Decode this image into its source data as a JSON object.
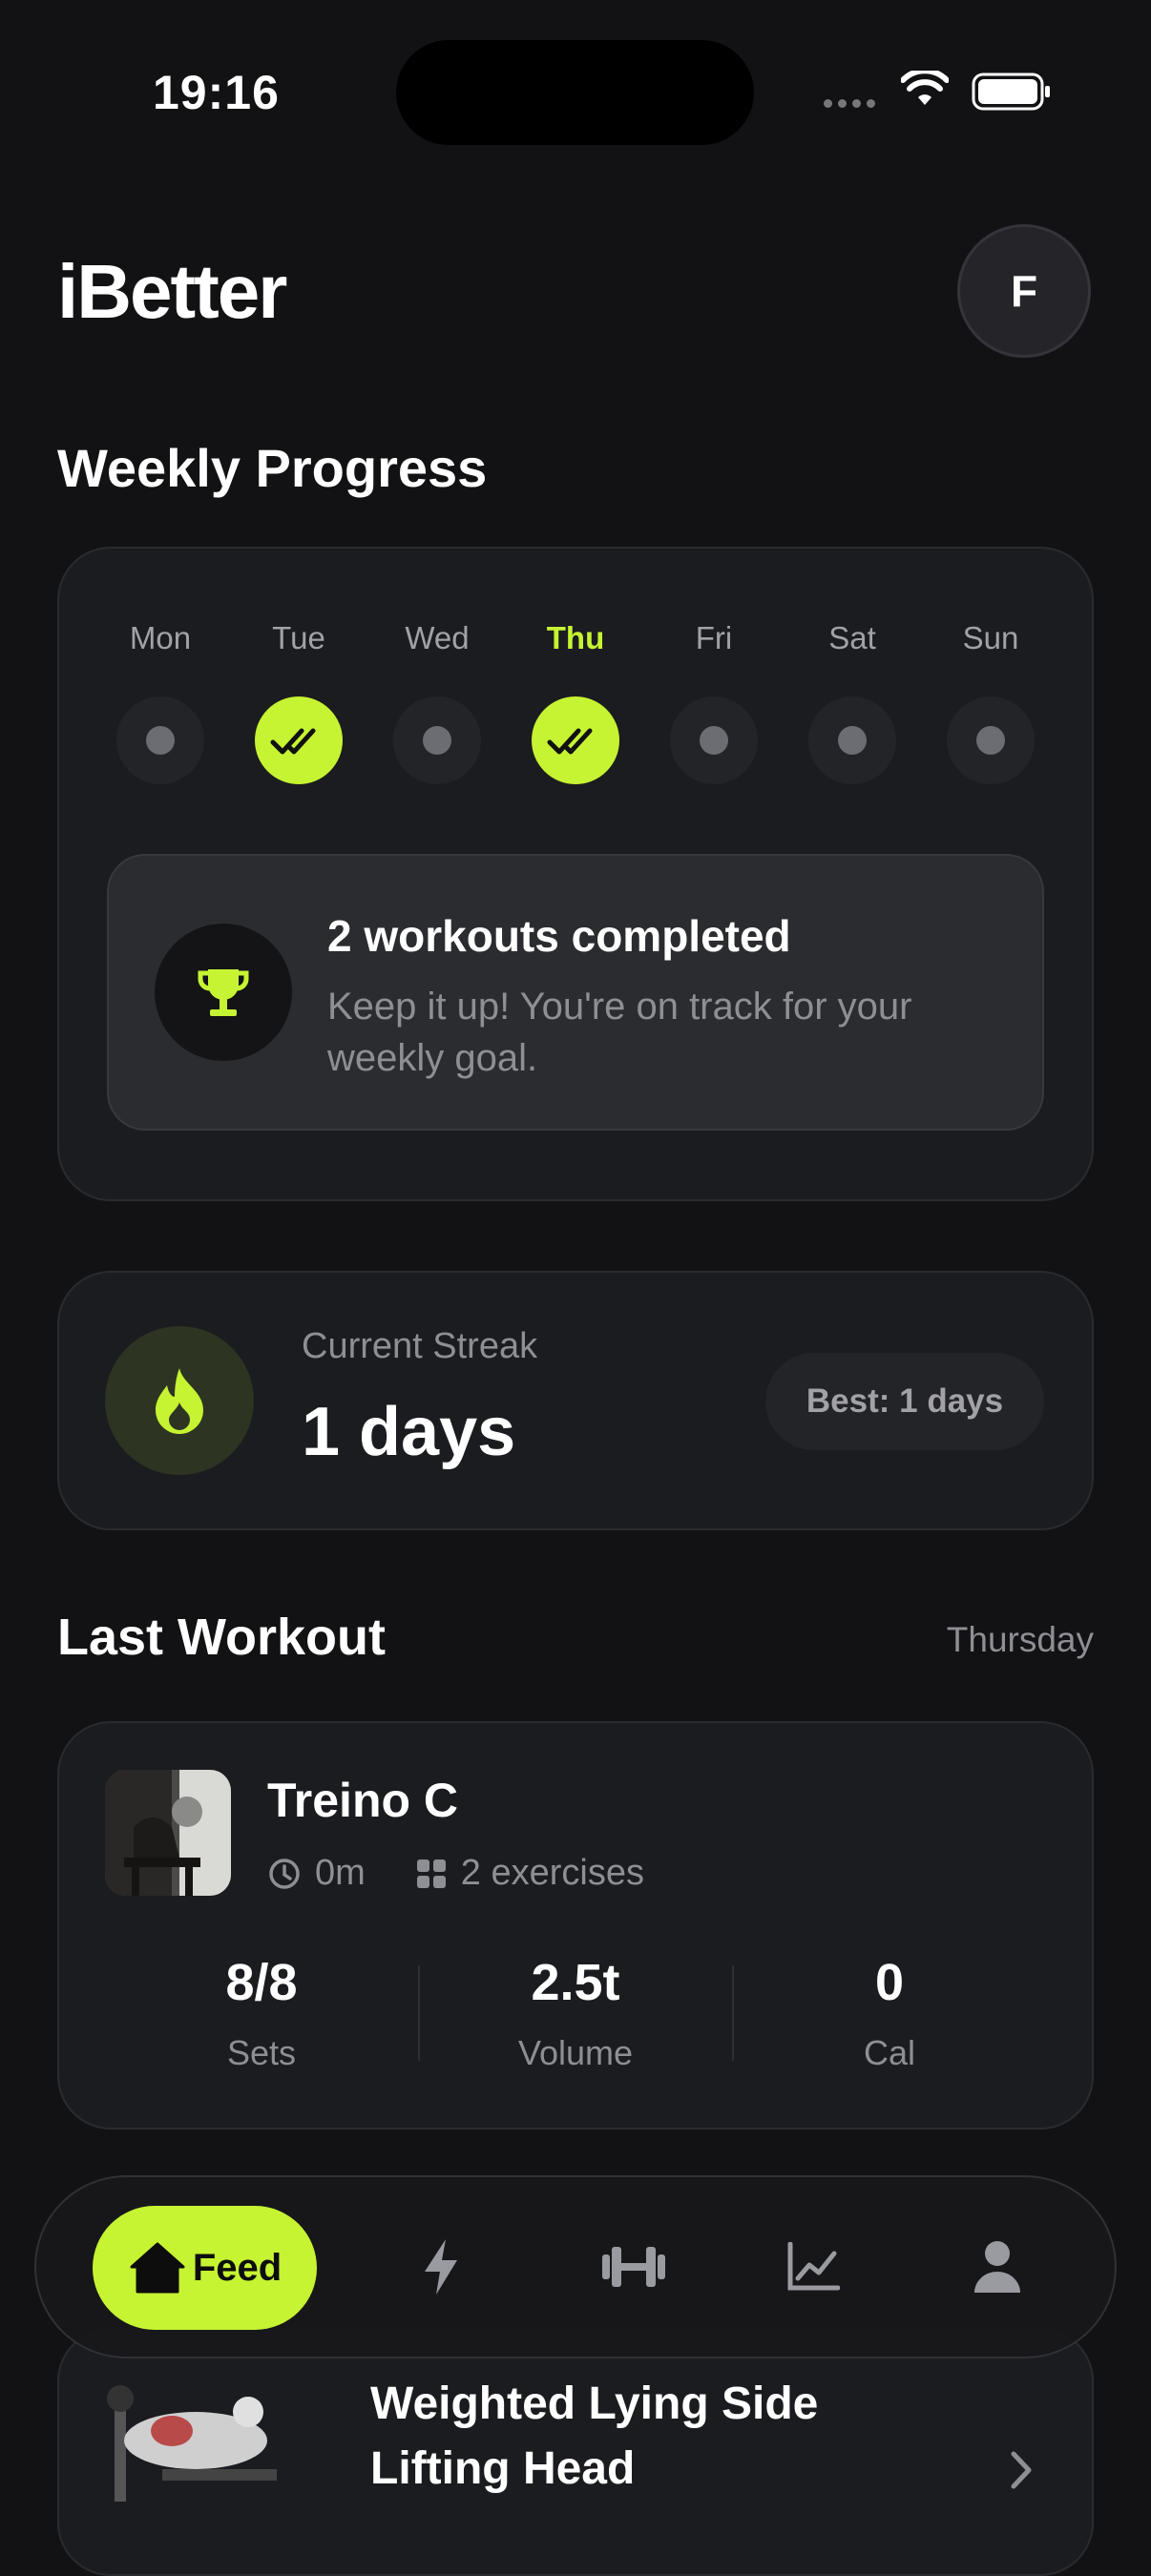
{
  "status_bar": {
    "time": "19:16"
  },
  "header": {
    "logo": "iBetter",
    "avatar_initial": "F"
  },
  "weekly_progress": {
    "title": "Weekly Progress",
    "days": [
      {
        "label": "Mon",
        "done": false,
        "today": false
      },
      {
        "label": "Tue",
        "done": true,
        "today": false
      },
      {
        "label": "Wed",
        "done": false,
        "today": false
      },
      {
        "label": "Thu",
        "done": true,
        "today": true
      },
      {
        "label": "Fri",
        "done": false,
        "today": false
      },
      {
        "label": "Sat",
        "done": false,
        "today": false
      },
      {
        "label": "Sun",
        "done": false,
        "today": false
      }
    ],
    "summary_title": "2 workouts completed",
    "summary_subtitle": "Keep it up! You're on track for your weekly goal."
  },
  "streak": {
    "label": "Current Streak",
    "value": "1 days",
    "best": "Best: 1 days"
  },
  "last_workout": {
    "title": "Last Workout",
    "day": "Thursday",
    "name": "Treino C",
    "duration": "0m",
    "exercises": "2 exercises",
    "stats": [
      {
        "value": "8/8",
        "label": "Sets"
      },
      {
        "value": "2.5t",
        "label": "Volume"
      },
      {
        "value": "0",
        "label": "Cal"
      }
    ]
  },
  "exercise_card": {
    "name": "Weighted Lying Side Lifting Head"
  },
  "tab_bar": {
    "feed_label": "Feed"
  },
  "colors": {
    "accent": "#c6f432",
    "background": "#121214",
    "card": "#1b1c1f"
  }
}
